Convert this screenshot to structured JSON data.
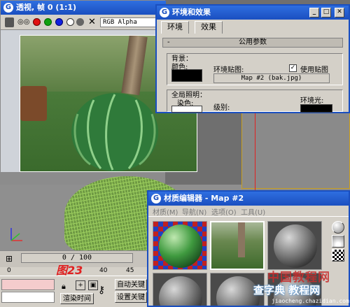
{
  "viewport": {
    "title": "透视, 帧 0 (1:1)",
    "channel": "RGB Alpha",
    "icons": [
      "save-icon",
      "copy-icon",
      "red-channel-icon",
      "green-channel-icon",
      "blue-channel-icon",
      "mono-channel-icon",
      "clear-icon"
    ]
  },
  "env_dialog": {
    "title": "环境和效果",
    "tabs": [
      "环境",
      "效果"
    ],
    "rollout_title": "公用参数",
    "background_group": "背景：",
    "color_label": "颜色:",
    "env_map_label": "环境贴图:",
    "use_map_label": "使用贴图",
    "use_map_checked": true,
    "map_button": "Map #2  (bak.jpg)",
    "global_lighting_group": "全局照明：",
    "tint_label": "染色:",
    "level_label": "级别:",
    "ambient_label": "环境光:",
    "bg_color": "#000000",
    "tint_color": "#ffffff",
    "ambient_color": "#000000"
  },
  "material_editor": {
    "title": "材质编辑器 - Map #2",
    "menu": [
      "材质(M)",
      "导航(N)",
      "选项(O)",
      "工具(U)"
    ]
  },
  "timeline": {
    "slider_text": "0 / 100",
    "ruler_marks": [
      "0",
      "40",
      "45"
    ],
    "figure_label": "图23"
  },
  "statusbar": {
    "render_time_label": "渲染时间",
    "auto_key_label": "自动关键",
    "set_key_label": "设置关键"
  },
  "watermark": {
    "main": "中国教程网",
    "sub": "查字典 教程网",
    "url": "jiaocheng.chazidian.com"
  },
  "colors": {
    "title_blue": "#1a4fc0",
    "link_line": "#e02020",
    "window_bg": "#d4d0c8"
  }
}
